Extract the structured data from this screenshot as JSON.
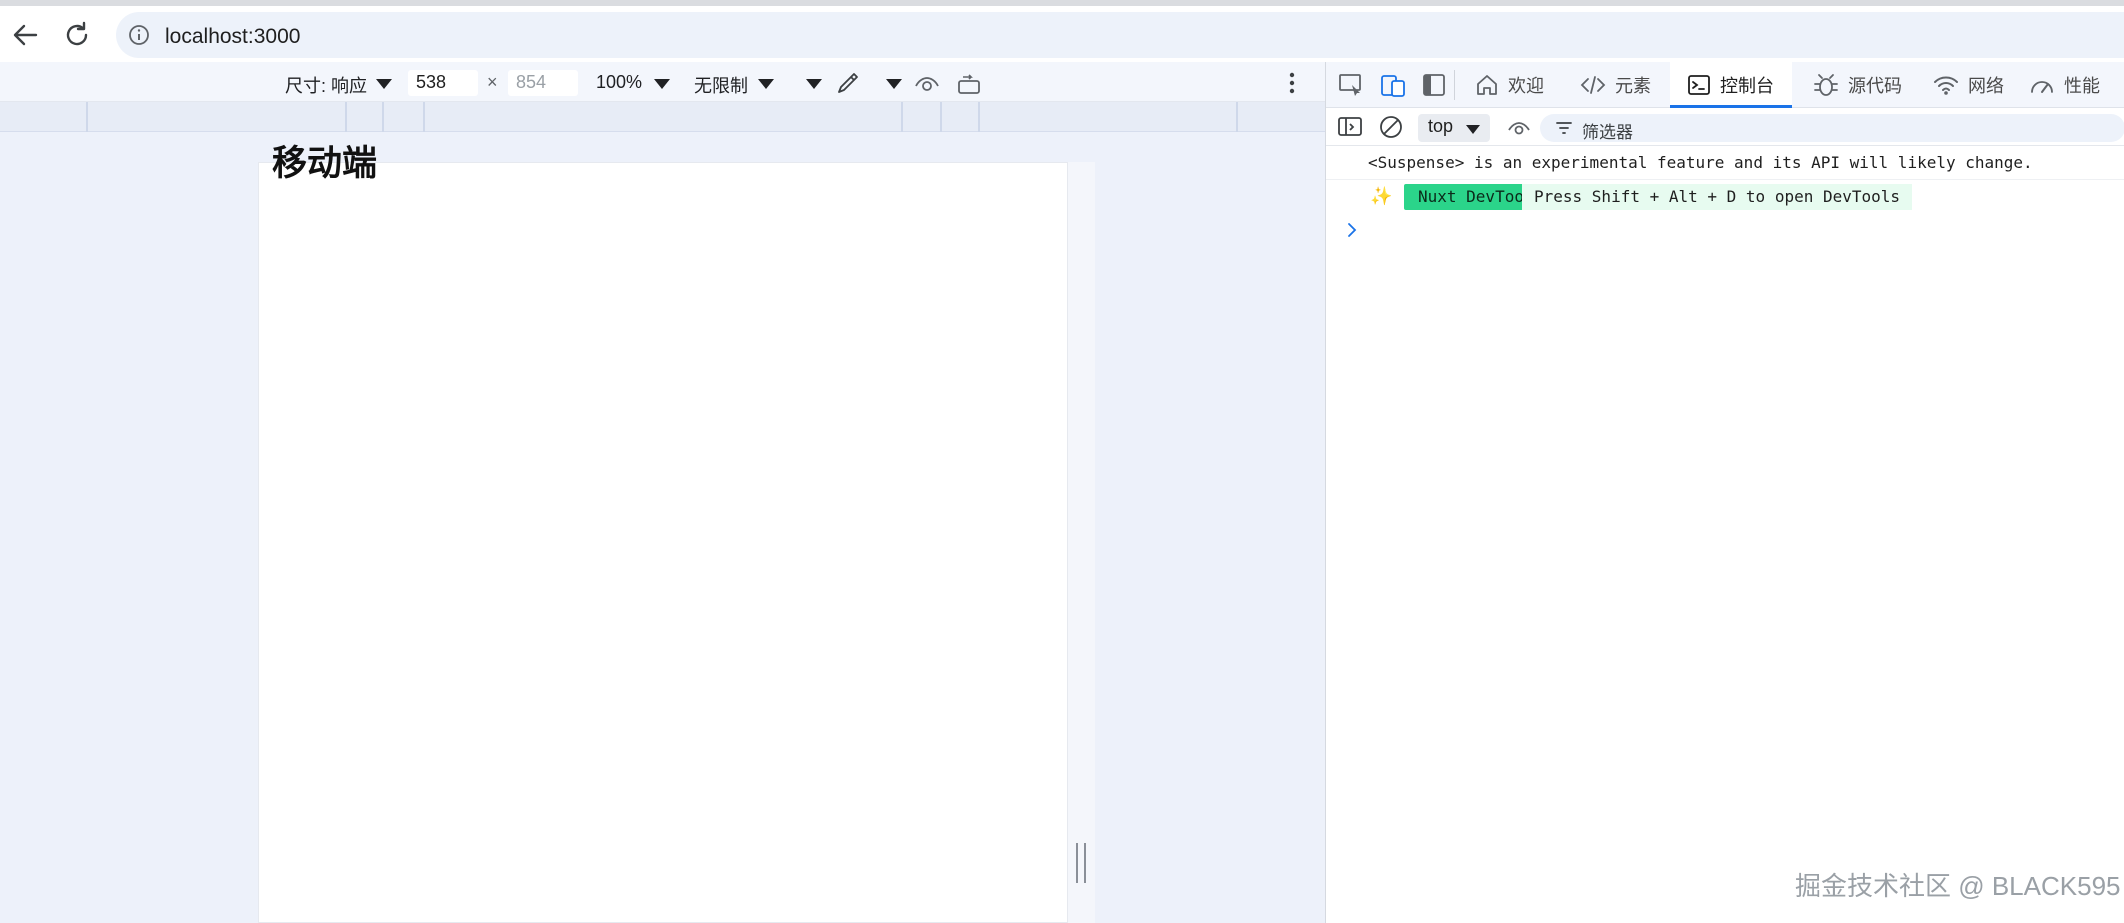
{
  "browser": {
    "url": "localhost:3000"
  },
  "emulation_toolbar": {
    "dimensions_label": "尺寸: 响应",
    "width_value": "538",
    "times_sign": "×",
    "height_value": "854",
    "zoom_label": "100%",
    "throttle_label": "无限制"
  },
  "page": {
    "heading": "移动端"
  },
  "devtools": {
    "tabs": [
      {
        "label": "欢迎",
        "icon": "home-icon"
      },
      {
        "label": "元素",
        "icon": "code-icon"
      },
      {
        "label": "控制台",
        "icon": "console-icon",
        "active": true
      },
      {
        "label": "源代码",
        "icon": "bug-icon"
      },
      {
        "label": "网络",
        "icon": "wifi-icon"
      },
      {
        "label": "性能",
        "icon": "gauge-icon"
      }
    ],
    "console_toolbar": {
      "context": "top",
      "filter_label": "筛选器"
    },
    "console": {
      "messages": [
        "<Suspense> is an experimental feature and its API will likely change."
      ],
      "nuxt_badge": "Nuxt DevTools",
      "nuxt_message": "Press Shift + Alt + D to open DevTools"
    }
  },
  "watermark": "掘金技术社区 @ BLACK595",
  "colors": {
    "accent": "#1a73e8",
    "nuxt_green": "#2bd48a",
    "pane_bg": "#edf1fa"
  }
}
